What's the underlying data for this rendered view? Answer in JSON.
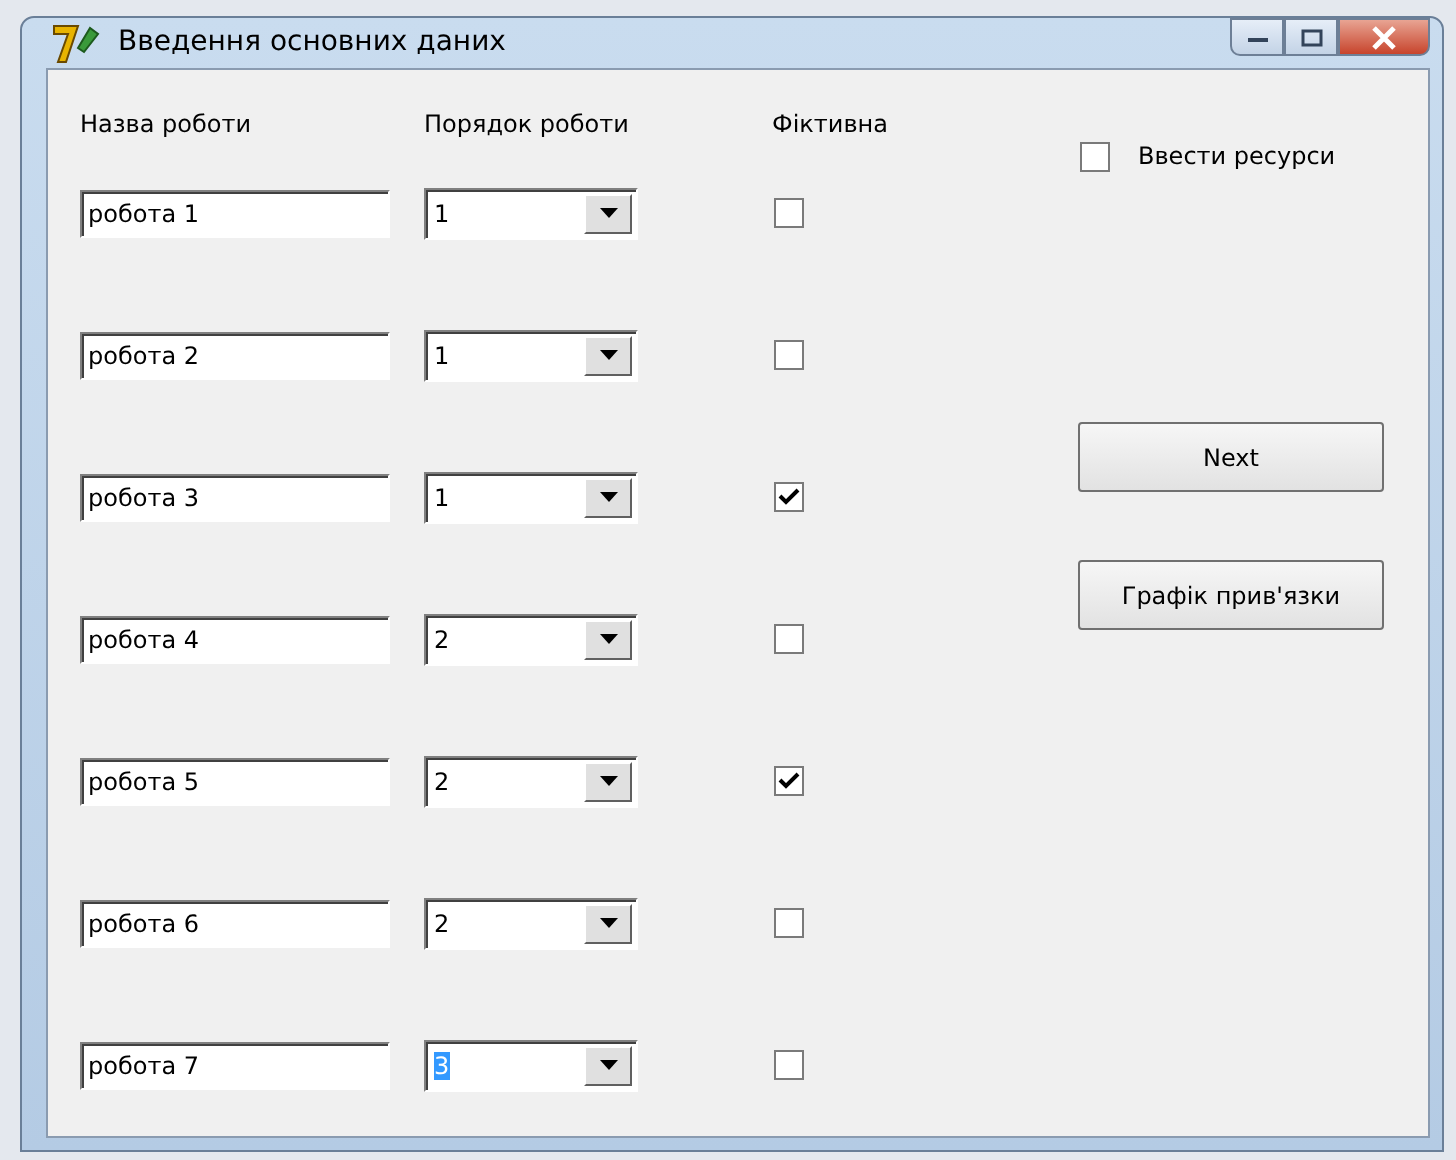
{
  "window": {
    "title": "Введення основних даних"
  },
  "headers": {
    "name": "Назва роботи",
    "order": "Порядок роботи",
    "fictive": "Фіктивна"
  },
  "rows": [
    {
      "name": "робота 1",
      "order": "1",
      "order_highlighted": false,
      "fictive": false
    },
    {
      "name": "робота 2",
      "order": "1",
      "order_highlighted": false,
      "fictive": false
    },
    {
      "name": "робота 3",
      "order": "1",
      "order_highlighted": false,
      "fictive": true
    },
    {
      "name": "робота 4",
      "order": "2",
      "order_highlighted": false,
      "fictive": false
    },
    {
      "name": "робота 5",
      "order": "2",
      "order_highlighted": false,
      "fictive": true
    },
    {
      "name": "робота 6",
      "order": "2",
      "order_highlighted": false,
      "fictive": false
    },
    {
      "name": "робота 7",
      "order": "3",
      "order_highlighted": true,
      "fictive": false
    }
  ],
  "resources_checkbox": {
    "label": "Ввести ресурси",
    "checked": false
  },
  "buttons": [
    "Next",
    "Графік прив'язки"
  ]
}
